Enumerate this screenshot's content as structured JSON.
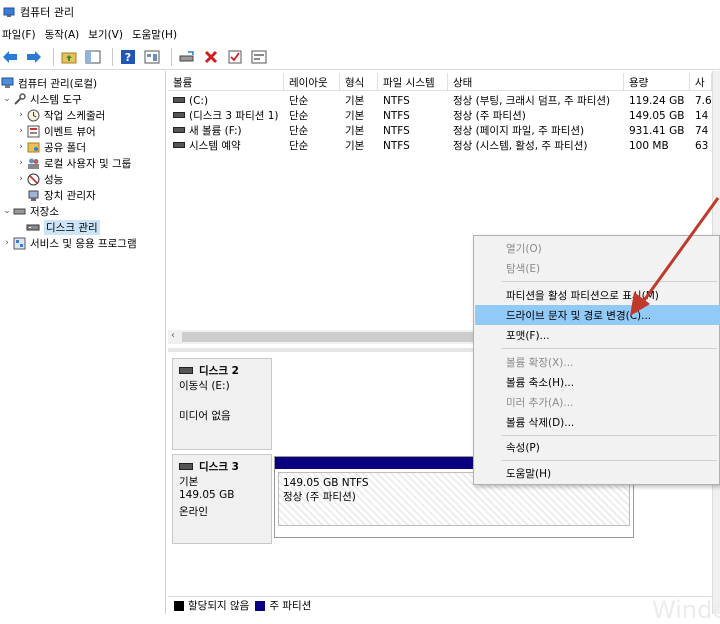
{
  "window": {
    "title": "컴퓨터 관리"
  },
  "menubar": {
    "items": [
      "파일(F)",
      "동작(A)",
      "보기(V)",
      "도움말(H)"
    ]
  },
  "toolbar": {
    "icons": [
      "back-arrow-icon",
      "forward-arrow-icon",
      "up-folder-icon",
      "show-tree-icon",
      "help-icon",
      "properties-icon",
      "connect-disk-icon",
      "delete-icon",
      "check-icon",
      "console-icon"
    ]
  },
  "tree": {
    "root": "컴퓨터 관리(로컬)",
    "items": [
      {
        "label": "시스템 도구",
        "icon": "tools-icon"
      },
      {
        "label": "작업 스케줄러",
        "icon": "clock-icon"
      },
      {
        "label": "이벤트 뷰어",
        "icon": "event-viewer-icon"
      },
      {
        "label": "공유 폴더",
        "icon": "shared-folder-icon"
      },
      {
        "label": "로컬 사용자 및 그룹",
        "icon": "users-icon"
      },
      {
        "label": "성능",
        "icon": "performance-icon"
      },
      {
        "label": "장치 관리자",
        "icon": "device-manager-icon"
      },
      {
        "label": "저장소",
        "icon": "storage-icon"
      },
      {
        "label": "디스크 관리",
        "icon": "disk-management-icon"
      },
      {
        "label": "서비스 및 응용 프로그램",
        "icon": "services-icon"
      }
    ]
  },
  "volumes": {
    "headers": [
      "볼륨",
      "레이아웃",
      "형식",
      "파일 시스템",
      "상태",
      "용량",
      "사"
    ],
    "rows": [
      {
        "name": "(C:)",
        "layout": "단순",
        "type": "기본",
        "fs": "NTFS",
        "status": "정상 (부팅, 크래시 덤프, 주 파티션)",
        "capacity": "119.24 GB",
        "free": "7.6"
      },
      {
        "name": "(디스크 3 파티션 1)",
        "layout": "단순",
        "type": "기본",
        "fs": "NTFS",
        "status": "정상 (주 파티션)",
        "capacity": "149.05 GB",
        "free": "14"
      },
      {
        "name": "새 볼륨 (F:)",
        "layout": "단순",
        "type": "기본",
        "fs": "NTFS",
        "status": "정상 (페이지 파일, 주 파티션)",
        "capacity": "931.41 GB",
        "free": "74"
      },
      {
        "name": "시스템 예약",
        "layout": "단순",
        "type": "기본",
        "fs": "NTFS",
        "status": "정상 (시스템, 활성, 주 파티션)",
        "capacity": "100 MB",
        "free": "63"
      }
    ]
  },
  "disks": [
    {
      "name": "디스크 2",
      "kind": "이동식 (E:)",
      "size": "",
      "state": "미디어 없음"
    },
    {
      "name": "디스크 3",
      "kind": "기본",
      "size": "149.05 GB",
      "state": "온라인",
      "partition": {
        "size_fs": "149.05 GB NTFS",
        "status": "정상 (주 파티션)"
      }
    }
  ],
  "legend": [
    {
      "label": "할당되지 않음",
      "color": "#000000"
    },
    {
      "label": "주 파티션",
      "color": "#0a007f"
    }
  ],
  "context_menu": {
    "items": [
      {
        "label": "열기(O)",
        "enabled": false
      },
      {
        "label": "탐색(E)",
        "enabled": false
      },
      {
        "label": "파티션을 활성 파티션으로 표시(M)",
        "enabled": true
      },
      {
        "label": "드라이브 문자 및 경로 변경(C)...",
        "enabled": true,
        "highlighted": true
      },
      {
        "label": "포맷(F)...",
        "enabled": true
      },
      {
        "label": "볼륨 확장(X)...",
        "enabled": false
      },
      {
        "label": "볼륨 축소(H)...",
        "enabled": true
      },
      {
        "label": "미러 추가(A)...",
        "enabled": false
      },
      {
        "label": "볼륨 삭제(D)...",
        "enabled": true
      },
      {
        "label": "속성(P)",
        "enabled": true
      },
      {
        "label": "도움말(H)",
        "enabled": true
      }
    ]
  },
  "annotation": {
    "arrow_color": "#c0392b"
  },
  "watermark": "Windo"
}
